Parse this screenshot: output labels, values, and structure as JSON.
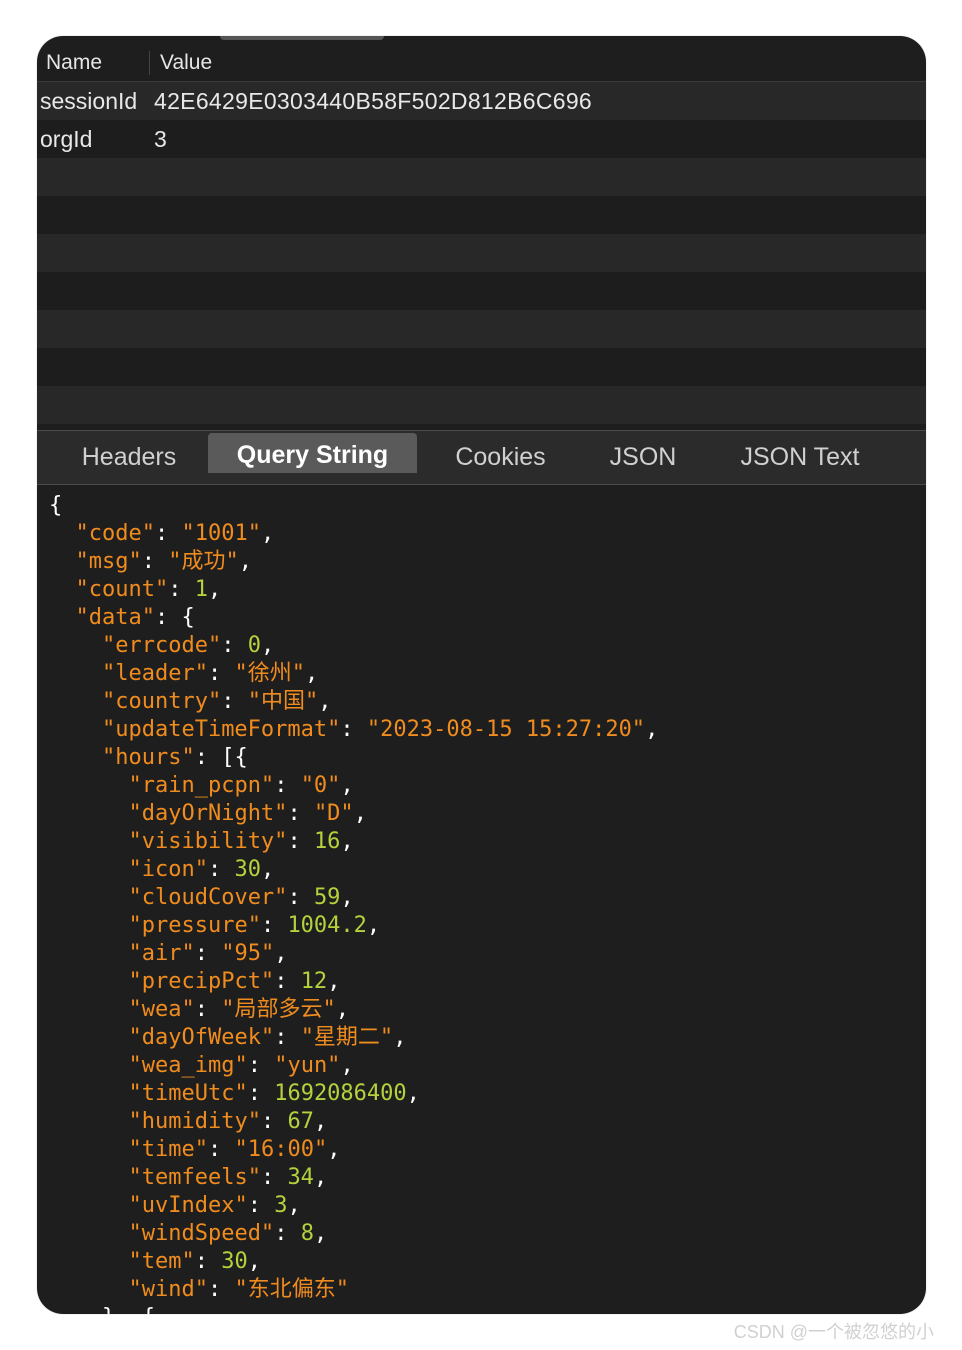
{
  "params_table": {
    "headers": {
      "name": "Name",
      "value": "Value"
    },
    "rows": [
      {
        "name": "sessionId",
        "value": "42E6429E0303440B58F502D812B6C696"
      },
      {
        "name": "orgId",
        "value": "3"
      }
    ]
  },
  "tabs": [
    {
      "label": "Headers",
      "active": false
    },
    {
      "label": "Query String",
      "active": true
    },
    {
      "label": "Cookies",
      "active": false
    },
    {
      "label": "JSON",
      "active": false
    },
    {
      "label": "JSON Text",
      "active": false
    }
  ],
  "json_body": {
    "top": [
      {
        "key": "code",
        "value": "\"1001\"",
        "type": "string"
      },
      {
        "key": "msg",
        "value": "\"成功\"",
        "type": "string"
      },
      {
        "key": "count",
        "value": "1",
        "type": "number"
      }
    ],
    "data_key": "data",
    "data": [
      {
        "key": "errcode",
        "value": "0",
        "type": "number"
      },
      {
        "key": "leader",
        "value": "\"徐州\"",
        "type": "string"
      },
      {
        "key": "country",
        "value": "\"中国\"",
        "type": "string"
      },
      {
        "key": "updateTimeFormat",
        "value": "\"2023-08-15 15:27:20\"",
        "type": "string"
      }
    ],
    "hours_key": "hours",
    "hours": [
      {
        "key": "rain_pcpn",
        "value": "\"0\"",
        "type": "string"
      },
      {
        "key": "dayOrNight",
        "value": "\"D\"",
        "type": "string"
      },
      {
        "key": "visibility",
        "value": "16",
        "type": "number"
      },
      {
        "key": "icon",
        "value": "30",
        "type": "number"
      },
      {
        "key": "cloudCover",
        "value": "59",
        "type": "number"
      },
      {
        "key": "pressure",
        "value": "1004.2",
        "type": "number"
      },
      {
        "key": "air",
        "value": "\"95\"",
        "type": "string"
      },
      {
        "key": "precipPct",
        "value": "12",
        "type": "number"
      },
      {
        "key": "wea",
        "value": "\"局部多云\"",
        "type": "string"
      },
      {
        "key": "dayOfWeek",
        "value": "\"星期二\"",
        "type": "string"
      },
      {
        "key": "wea_img",
        "value": "\"yun\"",
        "type": "string"
      },
      {
        "key": "timeUtc",
        "value": "1692086400",
        "type": "number"
      },
      {
        "key": "humidity",
        "value": "67",
        "type": "number"
      },
      {
        "key": "time",
        "value": "\"16:00\"",
        "type": "string"
      },
      {
        "key": "temfeels",
        "value": "34",
        "type": "number"
      },
      {
        "key": "uvIndex",
        "value": "3",
        "type": "number"
      },
      {
        "key": "windSpeed",
        "value": "8",
        "type": "number"
      },
      {
        "key": "tem",
        "value": "30",
        "type": "number"
      },
      {
        "key": "wind",
        "value": "\"东北偏东\"",
        "type": "string"
      }
    ]
  },
  "watermark": "CSDN @一个被忽悠的小"
}
